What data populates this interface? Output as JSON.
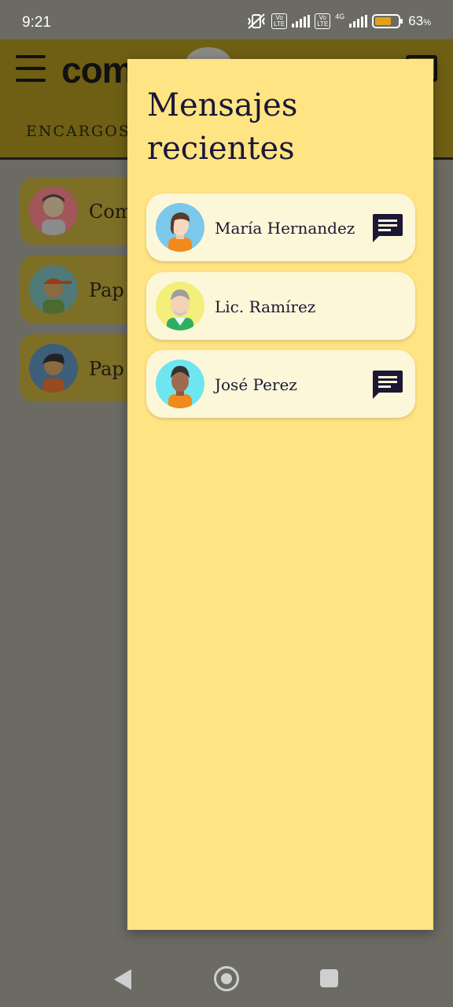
{
  "status_bar": {
    "time": "9:21",
    "volte_label": "Vo\nLTE",
    "network_label": "4G",
    "battery": "63",
    "battery_unit": "%",
    "battery_level": 0.63
  },
  "background_app": {
    "logo_text": "com",
    "tab_label": "ENCARGOS",
    "cards": [
      {
        "label": "Com"
      },
      {
        "label": "Pap"
      },
      {
        "label": "Pap"
      }
    ]
  },
  "drawer": {
    "title": "Mensajes recientes",
    "messages": [
      {
        "name": "María Hernandez",
        "avatar": "woman-avatar-icon",
        "unread": true
      },
      {
        "name": "Lic. Ramírez",
        "avatar": "old-man-avatar-icon",
        "unread": false
      },
      {
        "name": "José Perez",
        "avatar": "young-man-avatar-icon",
        "unread": true
      }
    ]
  },
  "colors": {
    "panel_bg": "#ffe483",
    "item_bg": "#fdf7d9",
    "text_dark": "#1b1735",
    "scrim": "#6b6a63"
  },
  "nav": {
    "back": "back-icon",
    "home": "home-icon",
    "recents": "recents-icon"
  }
}
